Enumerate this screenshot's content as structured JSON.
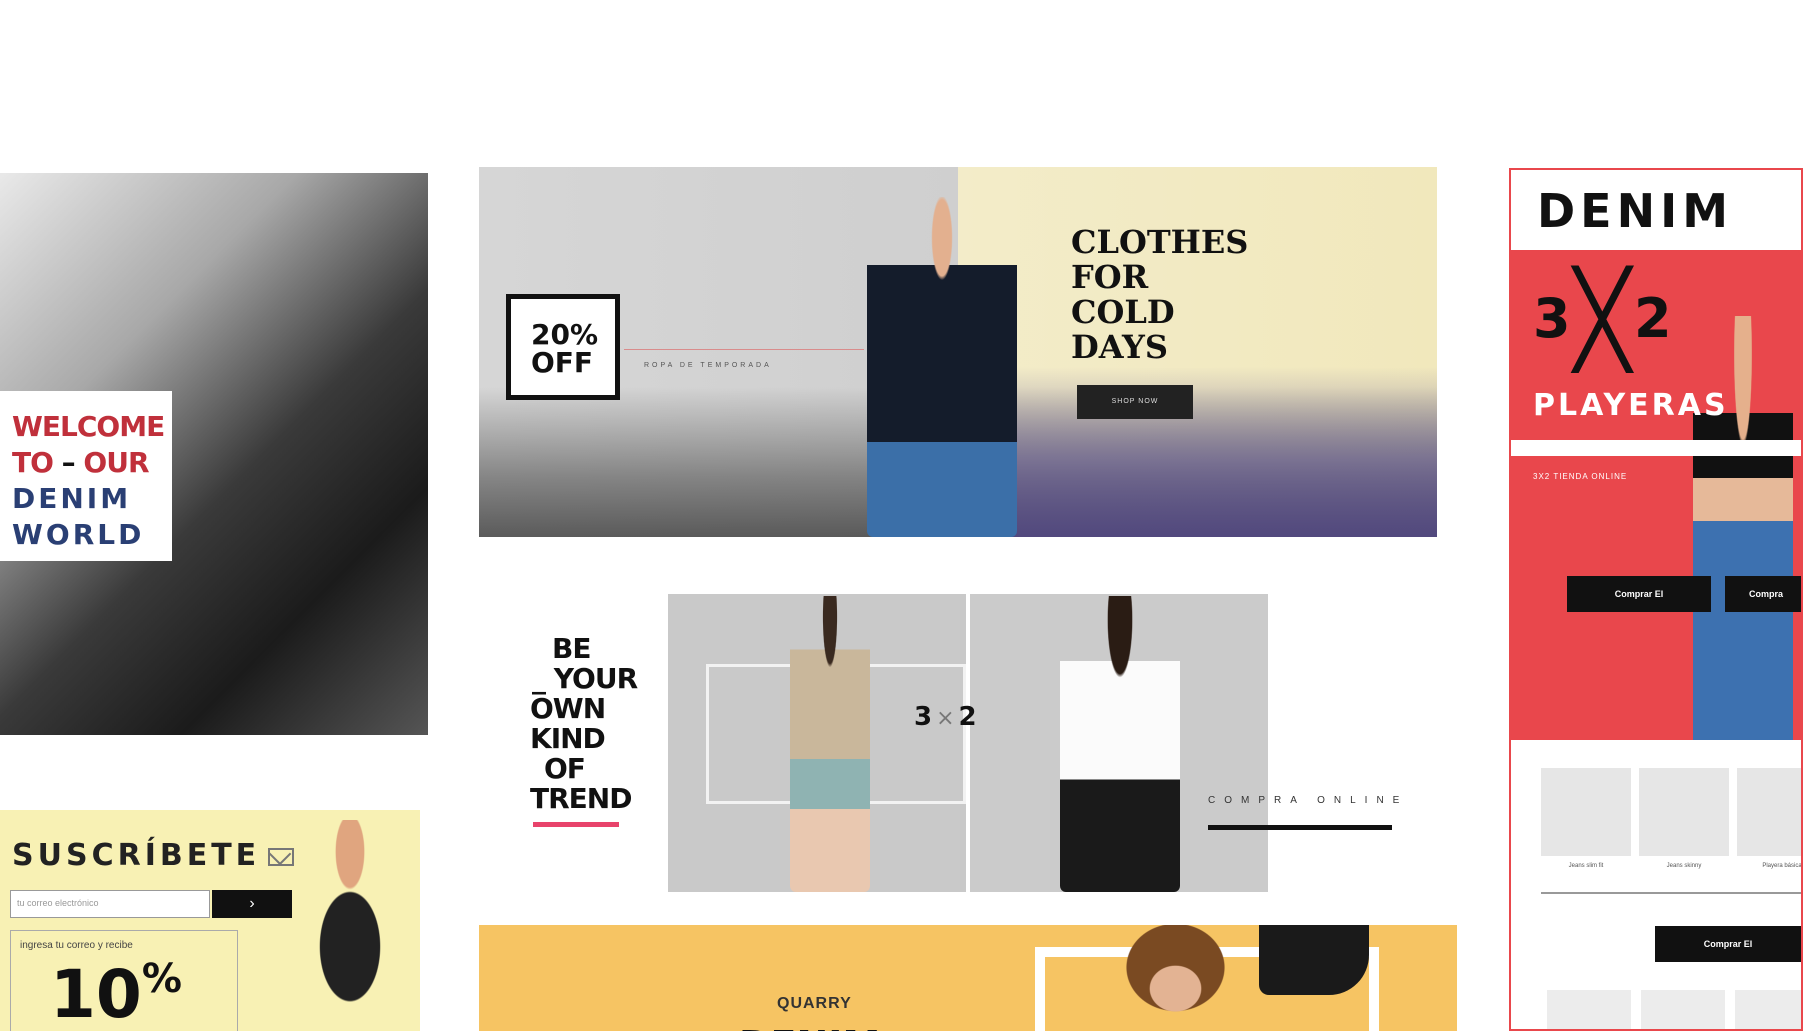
{
  "welcome": {
    "line1": "WELCOME",
    "line2_a": "TO",
    "line2_dash": " – ",
    "line2_b": "OUR",
    "line3": "DENIM",
    "line4": "WORLD"
  },
  "subscribe": {
    "title": "SUSCRÍBETE",
    "icon": "envelope-icon",
    "placeholder": "tu correo electrónico",
    "submit_label": "›",
    "promo_caption": "ingresa tu correo y recibe",
    "promo_value": "10",
    "promo_unit": "%"
  },
  "hero": {
    "badge_line1": "20%",
    "badge_line2": "OFF",
    "tagline": "ROPA DE TEMPORADA",
    "title": [
      "CLOTHES",
      "FOR",
      "COLD",
      "DAYS"
    ],
    "button_label": "SHOP NOW"
  },
  "trend": {
    "lines": [
      "BE",
      "_ YOUR",
      "OWN",
      "KIND",
      "OF",
      "TREND"
    ],
    "offer_a": "3",
    "offer_x": "×",
    "offer_b": "2",
    "cta": "COMPRA ONLINE",
    "accent": "#e8436b"
  },
  "quarry": {
    "label": "QUARRY",
    "headline": "DENIM"
  },
  "denim": {
    "title": "DENIM",
    "offer_a": "3",
    "offer_x": "╳",
    "offer_b": "2",
    "subtitle": "PLAYERAS",
    "tagline": "3X2 TIENDA ONLINE",
    "buy_label": "Comprar El",
    "buy_label_2": "Compra",
    "product_captions": [
      "Jeans slim fit",
      "Jeans skinny",
      "Playera básica"
    ],
    "buy_label_3": "Comprar El",
    "brand_color": "#e9474c"
  }
}
